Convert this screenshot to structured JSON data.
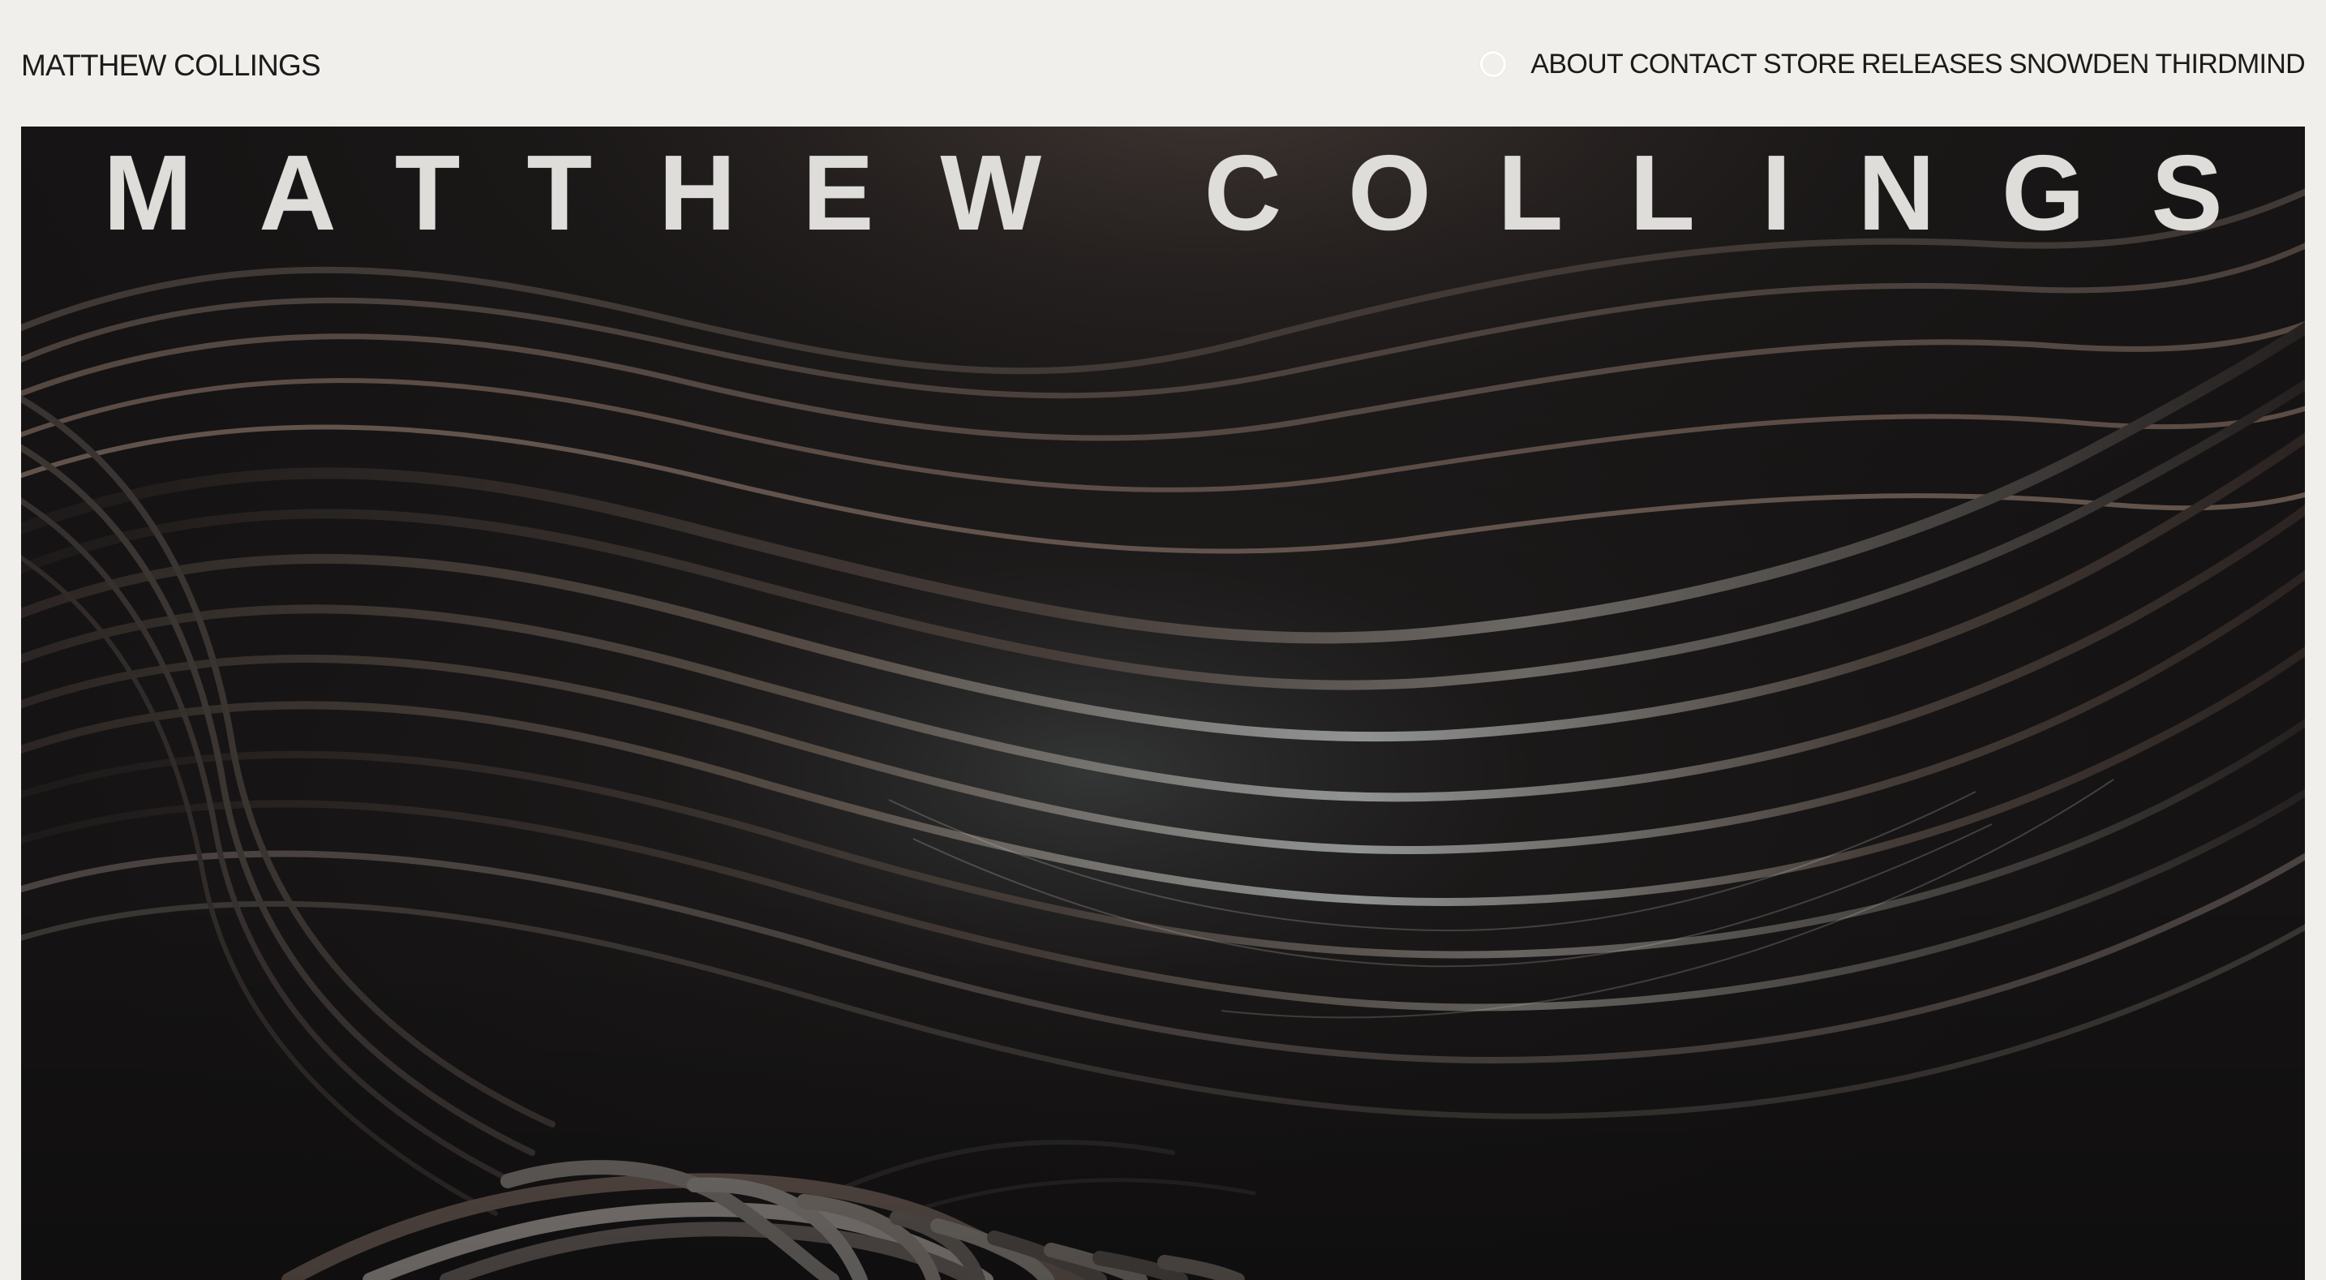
{
  "site": {
    "title": "MATTHEW COLLINGS"
  },
  "nav": {
    "toggle_icon": "circle-toggle-icon",
    "links": [
      {
        "label": "ABOUT"
      },
      {
        "label": "CONTACT"
      },
      {
        "label": "STORE"
      },
      {
        "label": "RELEASES"
      },
      {
        "label": "SNOWDEN"
      },
      {
        "label": "THIRDMIND"
      }
    ]
  },
  "hero": {
    "artist_title": "MATTHEW COLLINGS",
    "image_description": "dark-abstract-wave-artwork"
  },
  "colors": {
    "page_background": "#f0efeb",
    "text": "#1b1b1b",
    "hero_background": "#151313",
    "hero_text": "#deddda"
  }
}
